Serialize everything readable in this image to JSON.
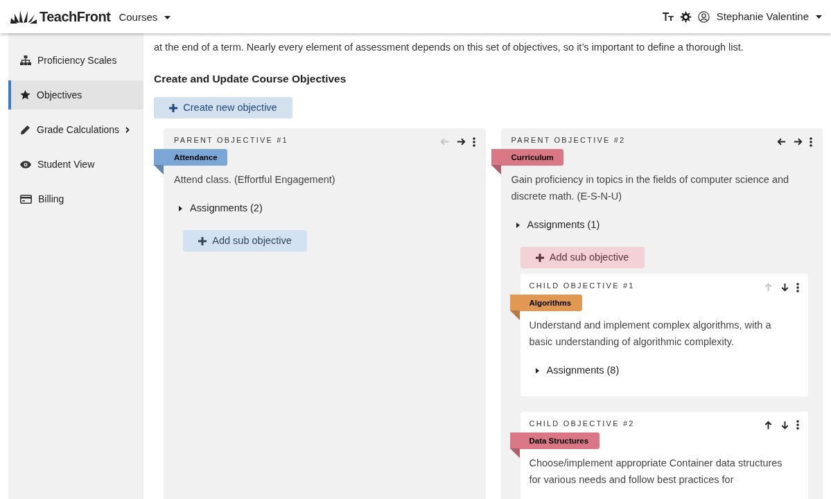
{
  "header": {
    "brand": "TeachFront",
    "menu": "Courses",
    "user": "Stephanie Valentine"
  },
  "sidebar": {
    "items": [
      {
        "kind": "sitemap",
        "label": "Proficiency Scales",
        "selected": false,
        "has_submenu": false
      },
      {
        "kind": "star",
        "label": "Objectives",
        "selected": true,
        "has_submenu": false
      },
      {
        "kind": "pencil",
        "label": "Grade Calculations",
        "selected": false,
        "has_submenu": true
      },
      {
        "kind": "eye",
        "label": "Student View",
        "selected": false,
        "has_submenu": false
      },
      {
        "kind": "card",
        "label": "Billing",
        "selected": false,
        "has_submenu": false
      }
    ]
  },
  "intro": "at the end of a term. Nearly every element of assessment depends on this set of objectives, so it’s important to define a thorough list.",
  "section_title": "Create and Update Course Objectives",
  "create_button": "Create new objective",
  "objectives": [
    {
      "heading": "PARENT OBJECTIVE #1",
      "tag": "Attendance",
      "color": "#7ba7d7",
      "moves": [
        {
          "kind": "left",
          "disabled": true
        },
        {
          "kind": "right",
          "disabled": false
        }
      ],
      "description": "Attend class. (Effortful Engagement)",
      "assignments": "Assignments (2)",
      "add_button": "Add sub objective"
    },
    {
      "heading": "PARENT OBJECTIVE #2",
      "tag": "Curriculum",
      "color": "#d97787",
      "moves": [
        {
          "kind": "left",
          "disabled": false
        },
        {
          "kind": "right",
          "disabled": false
        }
      ],
      "description": "Gain proficiency in topics in the fields of computer science and discrete math. (E-S-N-U)",
      "assignments": "Assignments (1)",
      "add_button": "Add sub objective",
      "children": [
        {
          "heading": "CHILD OBJECTIVE #1",
          "tag": "Algorithms",
          "color": "#e09852",
          "moves": [
            {
              "kind": "up",
              "disabled": true
            },
            {
              "kind": "down",
              "disabled": false
            }
          ],
          "description": "Understand and implement complex algorithms, with a basic understanding of algorithmic complexity.",
          "assignments": "Assignments (8)"
        },
        {
          "heading": "CHILD OBJECTIVE #2",
          "tag": "Data Structures",
          "color": "#d97787",
          "moves": [
            {
              "kind": "up",
              "disabled": false
            },
            {
              "kind": "down",
              "disabled": false
            }
          ],
          "description": "Choose/implement appropriate Container data structures for various needs and follow best practices for"
        }
      ]
    }
  ]
}
